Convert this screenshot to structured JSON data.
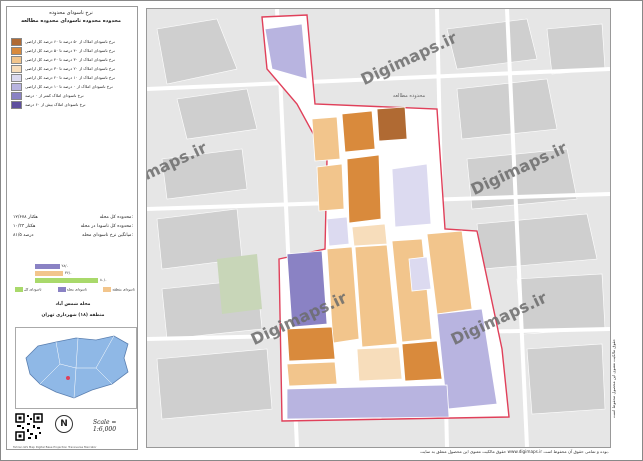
{
  "panel": {
    "title_line1": "نرخ ناسودای محدوده",
    "title_line2": "محدوده محدوده ناسودای محدوده مطالعه"
  },
  "legend": [
    {
      "label": "نرخ ناسودای املاک از ۵۰ درصد تا ۶۰ درصد کل اراضی",
      "color": "#b06a33"
    },
    {
      "label": "نرخ ناسودای املاک از ۴۰ درصد تا ۵۰ درصد کل اراضی",
      "color": "#d98a3c"
    },
    {
      "label": "نرخ ناسودای املاک از ۳۰ درصد تا ۴۰ درصد کل اراضی",
      "color": "#f2c58c"
    },
    {
      "label": "نرخ ناسودای املاک از ۲۰ درصد تا ۳۰ درصد کل اراضی",
      "color": "#f7ddbb"
    },
    {
      "label": "نرخ ناسودای املاک از ۱۰ درصد تا ۲۰ درصد کل اراضی",
      "color": "#dcdaf0"
    },
    {
      "label": "نرخ ناسودای املاک از ۰ درصد تا ۱۰ درصد کل اراضی",
      "color": "#b8b4e0"
    },
    {
      "label": "نرخ ناسودای املاک کمتر از ۰ درصد",
      "color": "#8a82c4"
    },
    {
      "label": "نرخ ناسودای املاک بیش از ۶۰ درصد",
      "color": "#5e4f9e"
    }
  ],
  "stats": [
    {
      "label": "محدوده کل محله:",
      "value": "۱۲/۶۷۸ هکتار"
    },
    {
      "label": "محدوده کل ناسودا در محله:",
      "value": "۱۰/۳۳ هکتار"
    },
    {
      "label": "میانگین نرخ ناسودای محله:",
      "value": "۸۱/۵ درصد"
    }
  ],
  "bars": [
    {
      "value": 0.35,
      "label": "۲۸/۰",
      "color": "#8a82c4"
    },
    {
      "value": 0.4,
      "label": "۳۶/۰",
      "color": "#f2c58c"
    },
    {
      "value": 0.9,
      "label": "۸۰/۰",
      "color": "#a9d96b"
    }
  ],
  "bar_legend": [
    {
      "label": "ناسودای کل",
      "color": "#a9d96b"
    },
    {
      "label": "ناسودای محله",
      "color": "#8a82c4"
    },
    {
      "label": "ناسودای منطقه",
      "color": "#f2c58c"
    }
  ],
  "location": {
    "title": "محله شمس آباد",
    "subtitle": "منطقه (۱۸) شهرداری تهران"
  },
  "scale_text": "Scale = 1:6,000",
  "north_label": "N",
  "credit": "Tehran  GIS Map Digital Base  Projection Transverse Mercator",
  "disclaimer": "حقوق مالکیت معنوی این محصول متعلق به سایت www.digimaps.ir بوده و تمامی حقوق آن محفوظ است.",
  "right_strip_text": "حقوق مالکیت معنوی این محصول محفوظ است",
  "watermark": "Digimaps.ir",
  "site_label": "محدوده مطالعه",
  "colors": {
    "boundary": "#e0405a",
    "background_map": "#e6e6e6",
    "streets": "#ffffff",
    "buildings": "#cfcfcf"
  }
}
